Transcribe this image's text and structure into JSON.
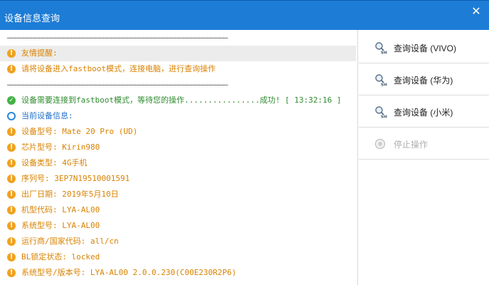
{
  "window": {
    "title": "设备信息查询",
    "close_label": "✕"
  },
  "log": {
    "separator": "———————————————————————————————————————————————————————",
    "lines": [
      {
        "icon": "warning-icon",
        "text": "友情提醒:"
      },
      {
        "icon": "warning-icon",
        "text": "请将设备进入fastboot模式，连接电脑，进行查询操作"
      },
      {
        "icon": "success-icon",
        "text": "设备需要连接到fastboot模式，等待您的操作................成功! [ 13:32:16 ]"
      },
      {
        "icon": "info-icon",
        "text": "当前设备信息:"
      },
      {
        "icon": "warning-icon",
        "text": "设备型号: Mate 20 Pro (UD)"
      },
      {
        "icon": "warning-icon",
        "text": "芯片型号: Kirin980"
      },
      {
        "icon": "warning-icon",
        "text": "设备类型: 4G手机"
      },
      {
        "icon": "warning-icon",
        "text": "序列号: 3EP7N19510001591"
      },
      {
        "icon": "warning-icon",
        "text": "出厂日期: 2019年5月10日"
      },
      {
        "icon": "warning-icon",
        "text": "机型代码: LYA-AL00"
      },
      {
        "icon": "warning-icon",
        "text": "系统型号: LYA-AL00"
      },
      {
        "icon": "warning-icon",
        "text": "运行商/国家代码: all/cn"
      },
      {
        "icon": "warning-icon",
        "text": "BL锁定状态: locked"
      },
      {
        "icon": "warning-icon",
        "text": "系统型号/版本号: LYA-AL00 2.0.0.230(C00E230R2P6)"
      }
    ]
  },
  "sidebar": {
    "buttons": [
      {
        "label": "查询设备 (VIVO)",
        "icon_text": "SH"
      },
      {
        "label": "查询设备 (华为)",
        "icon_text": "SH"
      },
      {
        "label": "查询设备 (小米)",
        "icon_text": "SH"
      },
      {
        "label": "停止操作"
      }
    ]
  },
  "colors": {
    "titlebar": "#1d7cd6",
    "warning": "#f0a21e",
    "success": "#41b245",
    "info": "#2a86db"
  }
}
